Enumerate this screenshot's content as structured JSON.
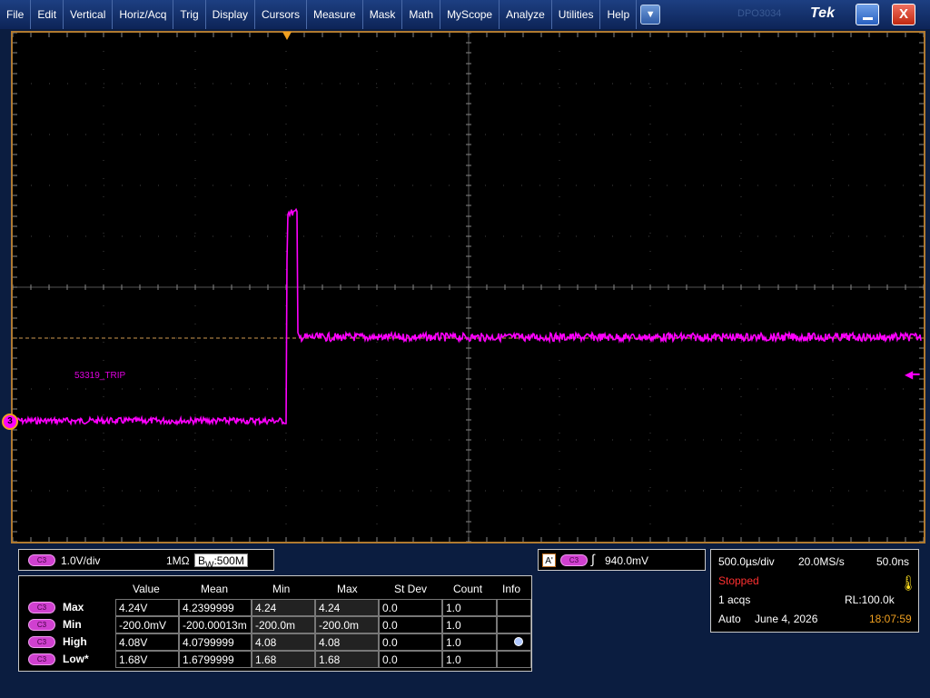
{
  "menu": {
    "items": [
      "File",
      "Edit",
      "Vertical",
      "Horiz/Acq",
      "Trig",
      "Display",
      "Cursors",
      "Measure",
      "Mask",
      "Math",
      "MyScope",
      "Analyze",
      "Utilities",
      "Help"
    ],
    "dropdown_icon": "chevron-down-icon",
    "brand_faint": "DPO3034",
    "brand": "Tek",
    "close_label": "X"
  },
  "screen": {
    "channel_marker": "3",
    "waveform_label": "53319_TRIP",
    "trace_color": "#ff00ff",
    "trigger_color": "#f0a020"
  },
  "vertical": {
    "channel": "C3",
    "scale": "1.0V/div",
    "impedance": "1MΩ",
    "bandwidth_prefix": "B",
    "bandwidth_sub": "W",
    "bandwidth": ":500M"
  },
  "trigger": {
    "mode_letter": "A'",
    "channel": "C3",
    "slope": "∫",
    "level": "940.0mV"
  },
  "horizontal": {
    "scale": "500.0µs/div",
    "sample_rate": "20.0MS/s",
    "resolution": "50.0ns",
    "state": "Stopped",
    "acqs": "1 acqs",
    "record_length": "RL:100.0k",
    "mode": "Auto",
    "date": "June 4, 2026",
    "time": "18:07:59"
  },
  "measurements": {
    "headers": [
      "Value",
      "Mean",
      "Min",
      "Max",
      "St Dev",
      "Count",
      "Info"
    ],
    "rows": [
      {
        "channel": "C3",
        "name": "Max",
        "value": "4.24V",
        "mean": "4.2399999",
        "min": "4.24",
        "max": "4.24",
        "stdev": "0.0",
        "count": "1.0"
      },
      {
        "channel": "C3",
        "name": "Min",
        "value": "-200.0mV",
        "mean": "-200.00013m",
        "min": "-200.0m",
        "max": "-200.0m",
        "stdev": "0.0",
        "count": "1.0"
      },
      {
        "channel": "C3",
        "name": "High",
        "value": "4.08V",
        "mean": "4.0799999",
        "min": "4.08",
        "max": "4.08",
        "stdev": "0.0",
        "count": "1.0"
      },
      {
        "channel": "C3",
        "name": "Low*",
        "value": "1.68V",
        "mean": "1.6799999",
        "min": "1.68",
        "max": "1.68",
        "stdev": "0.0",
        "count": "1.0"
      }
    ]
  }
}
